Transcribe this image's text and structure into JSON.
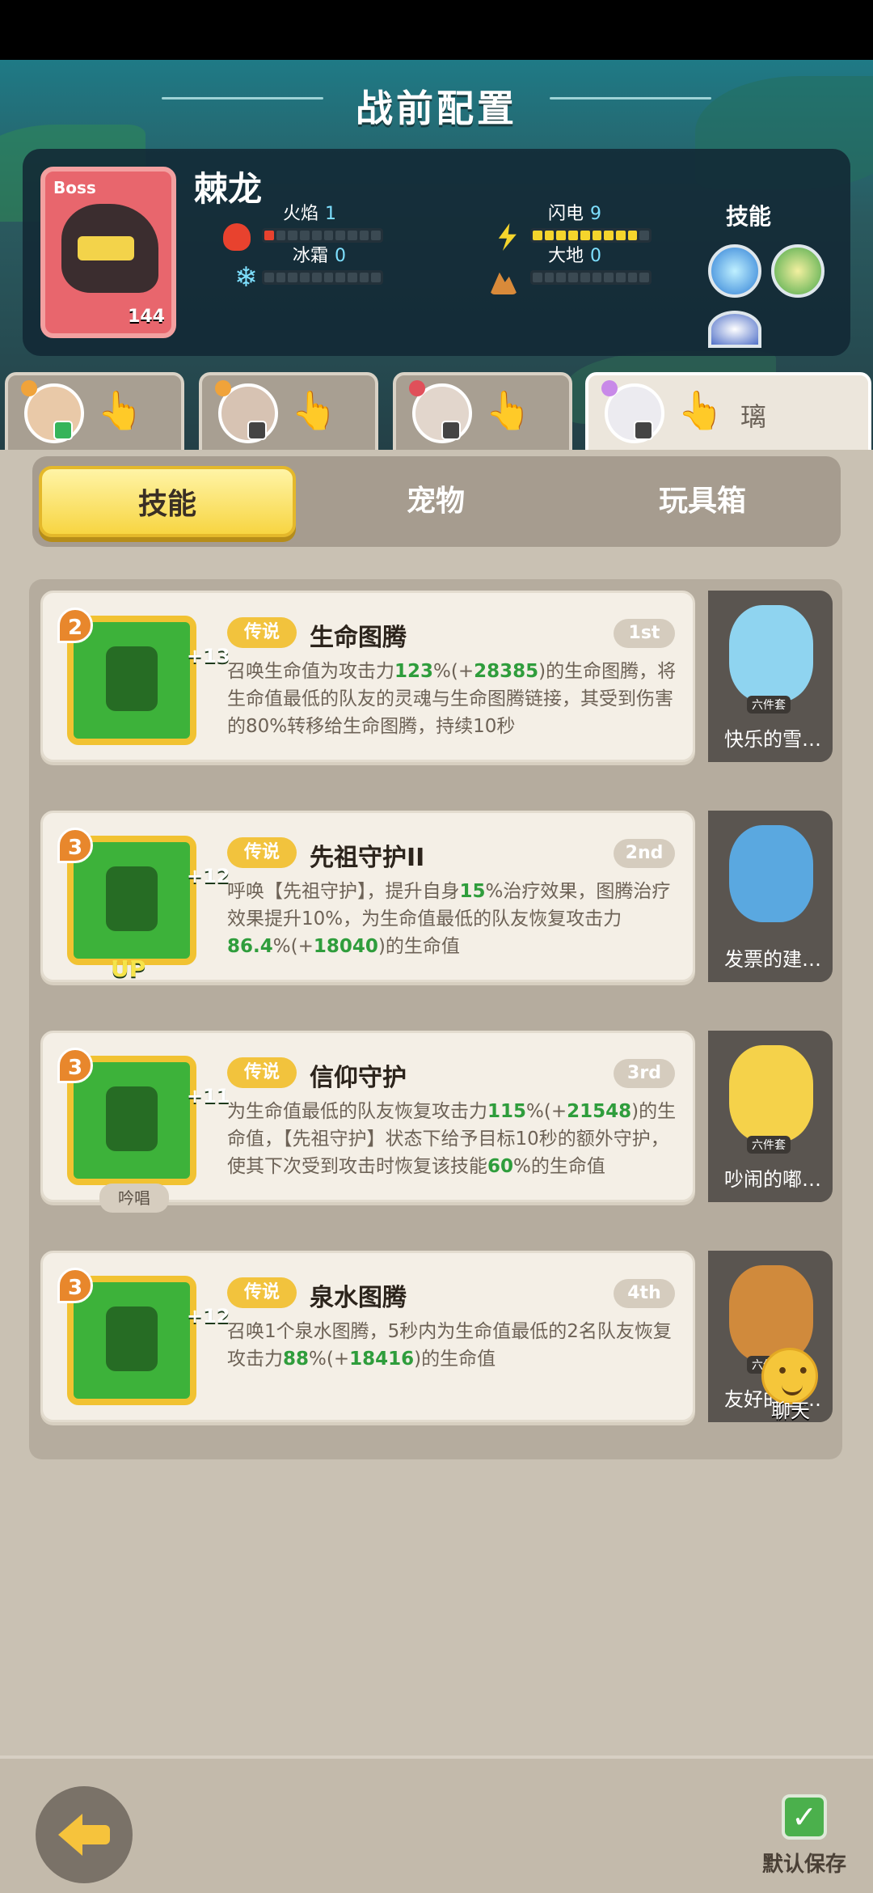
{
  "header": {
    "title": "战前配置"
  },
  "boss": {
    "badge": "Boss",
    "name": "棘龙",
    "level": "144",
    "elements": [
      {
        "name": "火焰",
        "value": "1",
        "filled": 1,
        "total": 10,
        "color": "#e8422e",
        "icon": "fire-icon"
      },
      {
        "name": "闪电",
        "value": "9",
        "filled": 9,
        "total": 10,
        "color": "#f5d52c",
        "icon": "lightning-icon"
      },
      {
        "name": "冰霜",
        "value": "0",
        "filled": 0,
        "total": 10,
        "color": "#7ee0ff",
        "icon": "snowflake-icon"
      },
      {
        "name": "大地",
        "value": "0",
        "filled": 0,
        "total": 10,
        "color": "#d98a3a",
        "icon": "mountain-icon"
      }
    ],
    "skills_label": "技能"
  },
  "heroes": [
    {
      "name": "",
      "active": false,
      "badge_color": "green",
      "mark_color": "#f0a33a"
    },
    {
      "name": "",
      "active": false,
      "badge_color": "gray",
      "mark_color": "#f0a33a"
    },
    {
      "name": "",
      "active": false,
      "badge_color": "gray",
      "mark_color": "#e0505a"
    },
    {
      "name": "璃",
      "active": true,
      "badge_color": "gray",
      "mark_color": "#c889e8"
    }
  ],
  "tabs": [
    {
      "label": "技能",
      "active": true
    },
    {
      "label": "宠物",
      "active": false
    },
    {
      "label": "玩具箱",
      "active": false
    }
  ],
  "skills": [
    {
      "level": "2",
      "plus": "+13",
      "up": "",
      "chant": "",
      "rarity": "传说",
      "name": "生命图腾",
      "rank": "1st",
      "desc_parts": [
        {
          "t": "召唤生命值为攻击力"
        },
        {
          "t": "123",
          "g": true
        },
        {
          "t": "%(+"
        },
        {
          "t": "28385",
          "g": true
        },
        {
          "t": ")的生命图腾，将生命值最低的队友的灵魂与生命图腾链接，其受到伤害的80%转移给生命图腾，持续10秒"
        }
      ],
      "pet": {
        "name": "快乐的雪…",
        "set": "六件套",
        "color": "#8fd4f0"
      }
    },
    {
      "level": "3",
      "plus": "+12",
      "up": "UP",
      "chant": "",
      "rarity": "传说",
      "name": "先祖守护II",
      "rank": "2nd",
      "desc_parts": [
        {
          "t": "呼唤【先祖守护】，提升自身"
        },
        {
          "t": "15",
          "g": true
        },
        {
          "t": "%治疗效果，图腾治疗效果提升10%，为生命值最低的队友恢复攻击力"
        },
        {
          "t": "86.4",
          "g": true
        },
        {
          "t": "%(+"
        },
        {
          "t": "18040",
          "g": true
        },
        {
          "t": ")的生命值"
        }
      ],
      "pet": {
        "name": "发票的建…",
        "set": "",
        "color": "#5aa8e0"
      }
    },
    {
      "level": "3",
      "plus": "+11",
      "up": "",
      "chant": "吟唱",
      "rarity": "传说",
      "name": "信仰守护",
      "rank": "3rd",
      "desc_parts": [
        {
          "t": "为生命值最低的队友恢复攻击力"
        },
        {
          "t": "115",
          "g": true
        },
        {
          "t": "%(+"
        },
        {
          "t": "21548",
          "g": true
        },
        {
          "t": ")的生命值，【先祖守护】状态下给予目标10秒的额外守护，使其下次受到攻击时恢复该技能"
        },
        {
          "t": "60",
          "g": true
        },
        {
          "t": "%的生命值"
        }
      ],
      "pet": {
        "name": "吵闹的嘟…",
        "set": "六件套",
        "color": "#f5d24a"
      }
    },
    {
      "level": "3",
      "plus": "+12",
      "up": "",
      "chant": "",
      "rarity": "传说",
      "name": "泉水图腾",
      "rank": "4th",
      "desc_parts": [
        {
          "t": "召唤1个泉水图腾，5秒内为生命值最低的2名队友恢复攻击力"
        },
        {
          "t": "88",
          "g": true
        },
        {
          "t": "%(+"
        },
        {
          "t": "18416",
          "g": true
        },
        {
          "t": ")的生命值"
        }
      ],
      "pet": {
        "name": "友好的巨…",
        "set": "六件套",
        "color": "#d08a3c"
      }
    }
  ],
  "chat": {
    "label": "聊天"
  },
  "footer": {
    "save_label": "默认保存",
    "back_icon": "back-arrow-icon",
    "save_icon": "checkbox-icon"
  }
}
